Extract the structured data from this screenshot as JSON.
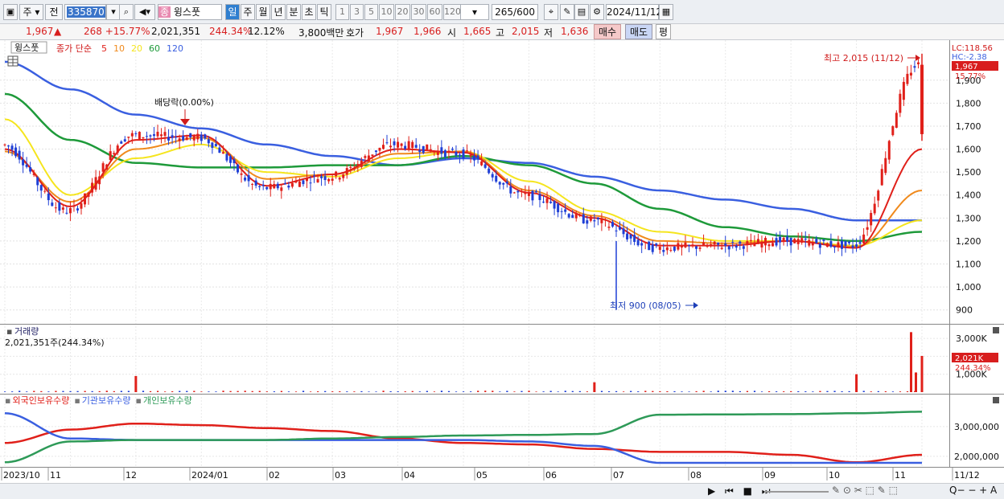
{
  "toolbar": {
    "period_label": "주",
    "prev_label": "전",
    "code": "335870",
    "stock_badge": "종",
    "stock_name": "윙스풋",
    "periods": [
      "일",
      "주",
      "월",
      "년",
      "분",
      "초",
      "틱"
    ],
    "selected_period": "일",
    "intervals": [
      "1",
      "3",
      "5",
      "10",
      "20",
      "30",
      "60",
      "120"
    ],
    "count": "265",
    "count_total": "/600",
    "date": "2024/11/12"
  },
  "info": {
    "price": "1,967",
    "change": "268 +15.77%",
    "volume": "2,021,351",
    "volume_ratio": "244.34%",
    "turnover": "12.12%",
    "amount": "3,800백만",
    "quote_label": "호가",
    "ask": "1,967",
    "bid": "1,966",
    "open_label": "시",
    "open": "1,665",
    "high_label": "고",
    "high": "2,015",
    "low_label": "저",
    "low": "1,636",
    "buy_label": "매수",
    "sell_label": "매도",
    "eval_label": "평"
  },
  "panel_price": {
    "name_tag": "윙스풋",
    "series_label": "종가 단순",
    "ma_labels": [
      "5",
      "10",
      "20",
      "60",
      "120"
    ],
    "lc": "LC:118.56",
    "hc": "HC:-2.38",
    "last_price_tag": "1,967",
    "last_pct_tag": "15.77%",
    "high_annot": "최고 2,015 (11/12)",
    "low_annot": "최저 900 (08/05)",
    "dividend_annot": "배당락(0.00%)"
  },
  "panel_volume": {
    "title": "거래량",
    "value_line": "2,021,351주(244.34%)",
    "last_tag": "2,021K",
    "last_pct": "244.34%"
  },
  "panel_holdings": {
    "legend": [
      "외국인보유수량",
      "기관보유수량",
      "개인보유수량"
    ]
  },
  "xaxis_labels": [
    "2023/10",
    "11",
    "12",
    "2024/01",
    "02",
    "03",
    "04",
    "05",
    "06",
    "07",
    "08",
    "09",
    "10",
    "11",
    "11/12"
  ],
  "colors": {
    "up": "#e0201a",
    "down": "#1f3fd6",
    "ma5": "#e0201a",
    "ma10": "#f08a1c",
    "ma20": "#f5e51e",
    "ma60": "#1e9a3a",
    "ma120": "#3a5fe0",
    "foreign": "#e0201a",
    "institution": "#3a5fe0",
    "individual": "#2e9a58"
  },
  "chart_data": [
    {
      "type": "line",
      "title": "",
      "xlabel": "",
      "ylabel": "",
      "ylim": [
        850,
        2060
      ],
      "yticks": [
        900,
        1000,
        1100,
        1200,
        1300,
        1400,
        1500,
        1600,
        1700,
        1800,
        1900
      ],
      "x": [
        "2023/10",
        "11",
        "12",
        "2024/01",
        "02",
        "03",
        "04",
        "05",
        "06",
        "07",
        "08",
        "09",
        "10",
        "11",
        "11/12"
      ],
      "series": [
        {
          "name": "종가",
          "values": [
            1620,
            1330,
            1660,
            1650,
            1430,
            1480,
            1620,
            1580,
            1400,
            1290,
            1170,
            1180,
            1200,
            1180,
            1967
          ]
        },
        {
          "name": "5",
          "values": [
            1600,
            1350,
            1640,
            1660,
            1440,
            1490,
            1600,
            1585,
            1410,
            1300,
            1180,
            1180,
            1200,
            1170,
            1600
          ]
        },
        {
          "name": "10",
          "values": [
            1590,
            1370,
            1600,
            1650,
            1470,
            1490,
            1580,
            1590,
            1420,
            1310,
            1200,
            1190,
            1200,
            1175,
            1420
          ]
        },
        {
          "name": "20",
          "values": [
            1730,
            1400,
            1560,
            1620,
            1500,
            1480,
            1560,
            1590,
            1460,
            1330,
            1240,
            1200,
            1200,
            1180,
            1290
          ]
        },
        {
          "name": "60",
          "values": [
            1840,
            1640,
            1540,
            1520,
            1520,
            1530,
            1530,
            1570,
            1530,
            1450,
            1340,
            1260,
            1220,
            1200,
            1240
          ]
        },
        {
          "name": "120",
          "values": [
            1980,
            1860,
            1750,
            1690,
            1620,
            1570,
            1530,
            1560,
            1540,
            1480,
            1420,
            1380,
            1340,
            1290,
            1290
          ]
        }
      ],
      "high": {
        "value": 2015,
        "date": "11/12"
      },
      "low": {
        "value": 900,
        "date": "08/05"
      }
    },
    {
      "type": "bar",
      "title": "거래량",
      "ylabel": "",
      "yticks": [
        "1,000K",
        "2,000K",
        "3,000K"
      ],
      "ylim": [
        0,
        3500
      ],
      "unit": "K",
      "x": [
        "2023/10",
        "11",
        "12",
        "2024/01",
        "02",
        "03",
        "04",
        "05",
        "06",
        "07",
        "08",
        "09",
        "10",
        "11",
        "11/12"
      ],
      "values": [
        60,
        60,
        900,
        70,
        50,
        60,
        70,
        60,
        50,
        550,
        80,
        40,
        40,
        1000,
        2021
      ]
    },
    {
      "type": "line",
      "title": "",
      "yticks": [
        "2,000,000",
        "3,000,000"
      ],
      "ylim": [
        1700000,
        3700000
      ],
      "x": [
        "2023/10",
        "11",
        "12",
        "2024/01",
        "02",
        "03",
        "04",
        "05",
        "06",
        "07",
        "08",
        "09",
        "10",
        "11",
        "11/12"
      ],
      "series": [
        {
          "name": "외국인보유수량",
          "values": [
            2450000,
            2900000,
            3100000,
            3050000,
            2950000,
            2850000,
            2600000,
            2450000,
            2400000,
            2250000,
            2150000,
            2150000,
            2050000,
            1800000,
            2050000
          ]
        },
        {
          "name": "기관보유수량",
          "values": [
            3450000,
            2600000,
            2550000,
            2550000,
            2550000,
            2550000,
            2550000,
            2550000,
            2500000,
            2350000,
            1780000,
            1780000,
            1780000,
            1780000,
            1780000
          ]
        },
        {
          "name": "개인보유수량",
          "values": [
            1800000,
            2500000,
            2550000,
            2550000,
            2550000,
            2600000,
            2650000,
            2700000,
            2720000,
            2750000,
            3400000,
            3410000,
            3420000,
            3450000,
            3500000
          ]
        }
      ]
    }
  ]
}
